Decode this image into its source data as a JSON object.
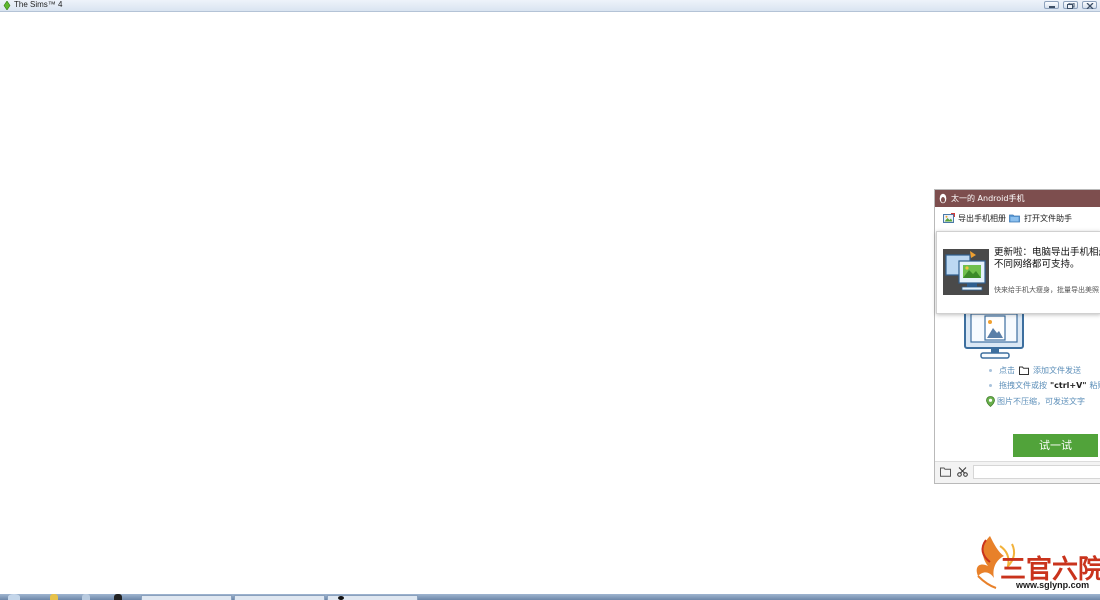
{
  "window": {
    "title": "The Sims™ 4",
    "buttons": [
      "minimize",
      "restore",
      "close"
    ]
  },
  "qq_panel": {
    "title": "太一的 Android手机",
    "header_color": "#7d4e4e",
    "toolbar": {
      "export_album_label": "导出手机相册",
      "open_file_helper_label": "打开文件助手"
    },
    "update_popup": {
      "headline_line1": "更新啦：电脑导出手机相册",
      "headline_line2": "不同网络都可支持。",
      "subtext": "快来给手机大瘦身，批量导出美照"
    },
    "hints": {
      "click_prefix": "点击",
      "add_file_send": "添加文件发送",
      "drag_prefix": "拖拽文件或按",
      "ctrl_v": "\"ctrl+V\"",
      "paste_suffix": "粘贴",
      "no_compress": "图片不压缩，可发送文字"
    },
    "try_button_label": "试一试",
    "try_button_color": "#51a33a",
    "bottom_icons": [
      "folder-icon",
      "scissors-icon"
    ]
  },
  "watermark": {
    "text": "三官六院",
    "url": "www.sglynp.com"
  },
  "taskbar": {
    "items": [
      "start-orb",
      "pinned-app-1",
      "pinned-app-2",
      "pinned-app-3",
      "task-window-1",
      "task-window-2",
      "task-window-3"
    ]
  }
}
